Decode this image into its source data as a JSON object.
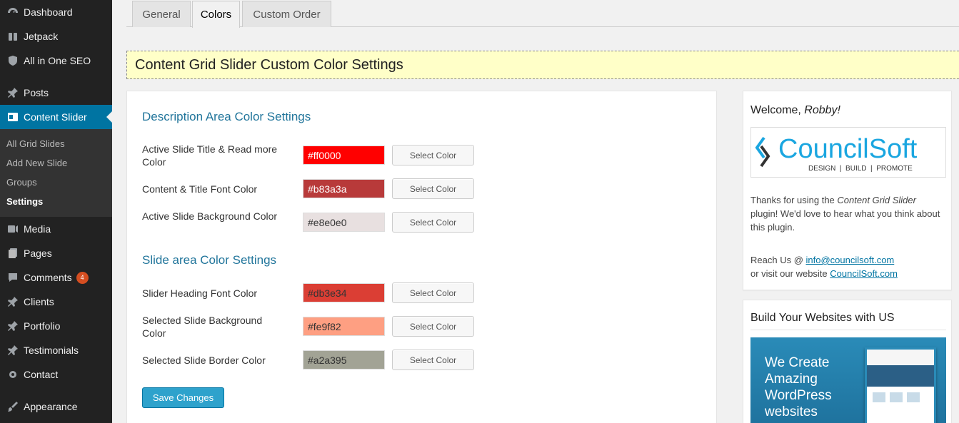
{
  "sidebar": {
    "items": [
      {
        "label": "Dashboard",
        "icon": "dashboard-icon"
      },
      {
        "label": "Jetpack",
        "icon": "jetpack-icon"
      },
      {
        "label": "All in One SEO",
        "icon": "shield-icon"
      },
      {
        "label": "Posts",
        "icon": "pin-icon"
      },
      {
        "label": "Content Slider",
        "icon": "slider-icon"
      },
      {
        "label": "Media",
        "icon": "media-icon"
      },
      {
        "label": "Pages",
        "icon": "pages-icon"
      },
      {
        "label": "Comments",
        "icon": "comments-icon",
        "badge": "4"
      },
      {
        "label": "Clients",
        "icon": "pin-icon"
      },
      {
        "label": "Portfolio",
        "icon": "pin-icon"
      },
      {
        "label": "Testimonials",
        "icon": "pin-icon"
      },
      {
        "label": "Contact",
        "icon": "gear-icon"
      },
      {
        "label": "Appearance",
        "icon": "brush-icon"
      }
    ],
    "submenu": [
      "All Grid Slides",
      "Add New Slide",
      "Groups",
      "Settings"
    ]
  },
  "tabs": [
    "General",
    "Colors",
    "Custom Order"
  ],
  "banner": {
    "title": "Content Grid Slider Custom Color Settings"
  },
  "sections": [
    {
      "title": "Description Area Color Settings",
      "rows": [
        {
          "label": "Active Slide Title & Read more Color",
          "value": "#ff0000",
          "color": "#ff0000",
          "text_color": "#ffffff"
        },
        {
          "label": "Content & Title Font Color",
          "value": "#b83a3a",
          "color": "#b83a3a",
          "text_color": "#ffffff"
        },
        {
          "label": "Active Slide Background Color",
          "value": "#e8e0e0",
          "color": "#e8e0e0",
          "text_color": "#333333"
        }
      ]
    },
    {
      "title": "Slide area Color Settings",
      "rows": [
        {
          "label": "Slider Heading Font Color",
          "value": "#db3e34",
          "color": "#db3e34",
          "text_color": "#333333"
        },
        {
          "label": "Selected Slide Background Color",
          "value": "#fe9f82",
          "color": "#fe9f82",
          "text_color": "#333333"
        },
        {
          "label": "Selected Slide Border Color",
          "value": "#a2a395",
          "color": "#a2a395",
          "text_color": "#333333"
        }
      ]
    }
  ],
  "select_color_label": "Select Color",
  "save_label": "Save Changes",
  "welcome": {
    "prefix": "Welcome, ",
    "name": "Robby!",
    "logo_text": "CouncilSoft",
    "logo_tagline": "DESIGN  |  BUILD  |  PROMOTE",
    "thanks_1": "Thanks for using the ",
    "plugin_name": "Content Grid Slider",
    "thanks_2": " plugin! We'd love to hear what you think about this plugin.",
    "reach_prefix": "Reach Us @ ",
    "email": "info@councilsoft.com",
    "visit_prefix": "or visit our website ",
    "website": "CouncilSoft.com"
  },
  "promo": {
    "title": "Build Your Websites with US",
    "lines": [
      "We Create",
      "Amazing",
      "WordPress",
      "websites"
    ]
  },
  "colors": {
    "sidebar_bg": "#222222",
    "active_menu": "#0074a2",
    "link": "#0074a2",
    "banner_bg": "#ffffc8",
    "primary_button": "#2ea2cc"
  }
}
